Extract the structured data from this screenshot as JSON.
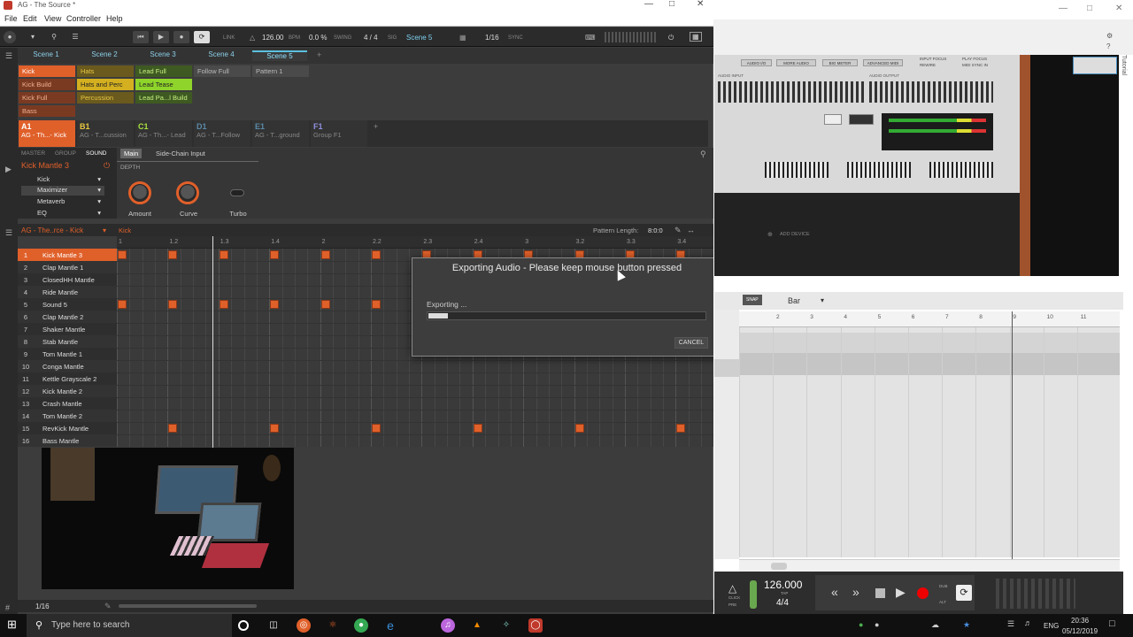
{
  "maschine": {
    "title": "AG - The Source *",
    "menu": [
      "File",
      "Edit",
      "View",
      "Controller",
      "Help"
    ],
    "transport": {
      "link": "LINK",
      "bpm_value": "126.00",
      "bpm_label": "BPM",
      "swing_value": "0.0 %",
      "swing_label": "SWING",
      "sig_value": "4 / 4",
      "sig_label": "SIG",
      "scene": "Scene 5",
      "quant": "1/16",
      "sync": "SYNC"
    },
    "scenes": [
      "Scene 1",
      "Scene 2",
      "Scene 3",
      "Scene 4",
      "Scene 5"
    ],
    "active_scene_index": 4,
    "clips": [
      {
        "label": "Kick",
        "col": 0,
        "row": 0,
        "color": "#e0602a"
      },
      {
        "label": "Kick Build",
        "col": 0,
        "row": 1,
        "color": "#7a3a22"
      },
      {
        "label": "Kick Full",
        "col": 0,
        "row": 2,
        "color": "#7a3a22"
      },
      {
        "label": "Bass",
        "col": 0,
        "row": 3,
        "color": "#7a3a22"
      },
      {
        "label": "Hats",
        "col": 1,
        "row": 0,
        "color": "#6b5a1e"
      },
      {
        "label": "Hats and Perc",
        "col": 1,
        "row": 1,
        "color": "#d4b020"
      },
      {
        "label": "Percussion",
        "col": 1,
        "row": 2,
        "color": "#6b5a1e"
      },
      {
        "label": "Lead Full",
        "col": 2,
        "row": 0,
        "color": "#3e5a22"
      },
      {
        "label": "Lead Tease",
        "col": 2,
        "row": 1,
        "color": "#8fd42a"
      },
      {
        "label": "Lead Pa...l Build",
        "col": 2,
        "row": 2,
        "color": "#3e5a22"
      },
      {
        "label": "Follow Full",
        "col": 3,
        "row": 0,
        "color": "#4a4a4a"
      },
      {
        "label": "Pattern 1",
        "col": 4,
        "row": 0,
        "color": "#4a4a4a"
      }
    ],
    "groups": [
      {
        "id": "A1",
        "name": "AG - Th...- Kick",
        "color": "#e0602a",
        "text": "#ffffff"
      },
      {
        "id": "B1",
        "name": "AG - T...cussion",
        "color": "#333333",
        "text": "#e8c840"
      },
      {
        "id": "C1",
        "name": "AG - Th...- Lead",
        "color": "#333333",
        "text": "#a8e040"
      },
      {
        "id": "D1",
        "name": "AG - T...Follow",
        "color": "#333333",
        "text": "#5a8aa8"
      },
      {
        "id": "E1",
        "name": "AG - T...ground",
        "color": "#333333",
        "text": "#5a8aa8"
      },
      {
        "id": "F1",
        "name": "Group F1",
        "color": "#333333",
        "text": "#9090e0"
      }
    ],
    "sound_tabs": [
      "MASTER",
      "GROUP",
      "SOUND"
    ],
    "sound_name": "Kick Mantle 3",
    "plugin_slots": [
      "Kick",
      "Maximizer",
      "Metaverb",
      "EQ"
    ],
    "plugin_tabs": [
      "Main",
      "Side-Chain Input"
    ],
    "section": "DEPTH",
    "knobs": [
      "Amount",
      "Curve",
      "Turbo"
    ],
    "pattern_group": "AG - The..rce - Kick",
    "pattern_name": "Kick",
    "pattern_length_label": "Pattern Length:",
    "pattern_length_value": "8:0:0",
    "ruler": [
      "1",
      "1.2",
      "1.3",
      "1.4",
      "2",
      "2.2",
      "2.3",
      "2.4",
      "3",
      "3.2",
      "3.3",
      "3.4"
    ],
    "sounds": [
      "Kick Mantle 3",
      "Clap Mantle 1",
      "ClosedHH Mantle",
      "Ride Mantle",
      "Sound 5",
      "Clap Mantle 2",
      "Shaker Mantle",
      "Stab Mantle",
      "Tom Mantle 1",
      "Conga Mantle",
      "Kettle Grayscale 2",
      "Kick Mantle 2",
      "Crash Mantle",
      "Tom Mantle 2",
      "RevKick Mantle",
      "Bass Mantle"
    ],
    "numbers": [
      "1",
      "2",
      "3",
      "4",
      "5",
      "6",
      "7",
      "8",
      "9",
      "10",
      "11",
      "12",
      "13",
      "14",
      "15",
      "16"
    ],
    "notes": {
      "0": [
        0,
        1,
        2,
        3,
        4,
        5,
        6,
        7,
        8,
        9,
        10,
        11
      ],
      "4": [
        0,
        1,
        2,
        3,
        4,
        5
      ],
      "14": [
        1,
        3,
        5,
        7,
        9,
        11
      ]
    },
    "bottom_quant": "1/16"
  },
  "dialog": {
    "title": "Exporting Audio - Please keep mouse button pressed",
    "status": "Exporting ...",
    "progress": 0.07,
    "cancel": "CANCEL"
  },
  "reason": {
    "rack_buttons": [
      "AUDIO I/O",
      "MORE AUDIO",
      "BIG METER",
      "ADVANCED MIDI"
    ],
    "status_labels": [
      "INPUT FOCUS",
      "REWIRE",
      "PLAY FOCUS",
      "MIDI SYNC IN"
    ],
    "audio_input": "AUDIO INPUT",
    "audio_output": "AUDIO OUTPUT",
    "add_device": "ADD DEVICE",
    "snap": "SNAP",
    "grid_value": "Bar",
    "seq_ruler": [
      "2",
      "3",
      "4",
      "5",
      "6",
      "7",
      "8",
      "9",
      "10",
      "11"
    ],
    "tempo": "126.000",
    "tap": "TAP",
    "signature": "4/4",
    "click": "CLICK",
    "pre": "PRE",
    "dub": "DUB",
    "alt": "ALT",
    "tutorial": "Tutorial"
  },
  "taskbar": {
    "search_placeholder": "Type here to search",
    "lang": "ENG",
    "time": "20:36",
    "date": "05/12/2019"
  }
}
